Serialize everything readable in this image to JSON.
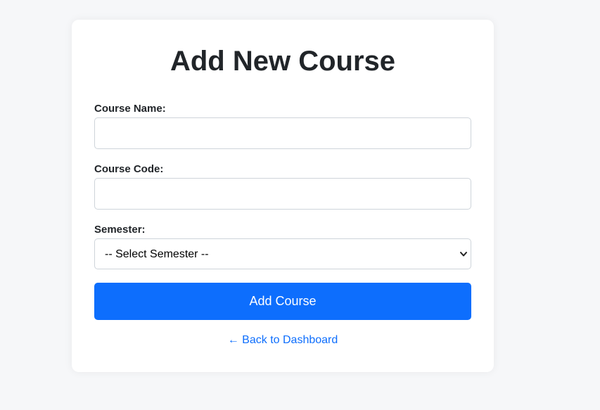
{
  "form": {
    "title": "Add New Course",
    "course_name": {
      "label": "Course Name:",
      "value": "",
      "placeholder": ""
    },
    "course_code": {
      "label": "Course Code:",
      "value": "",
      "placeholder": ""
    },
    "semester": {
      "label": "Semester:",
      "selected": "-- Select Semester --"
    },
    "submit_label": "Add Course",
    "back_link": "← Back to Dashboard"
  },
  "colors": {
    "page_bg": "#f6f7f9",
    "card_bg": "#ffffff",
    "primary": "#0d6efd",
    "text": "#212529",
    "input_border": "#ced4da"
  },
  "icons": {
    "select_arrow": "chevron-down-icon"
  }
}
